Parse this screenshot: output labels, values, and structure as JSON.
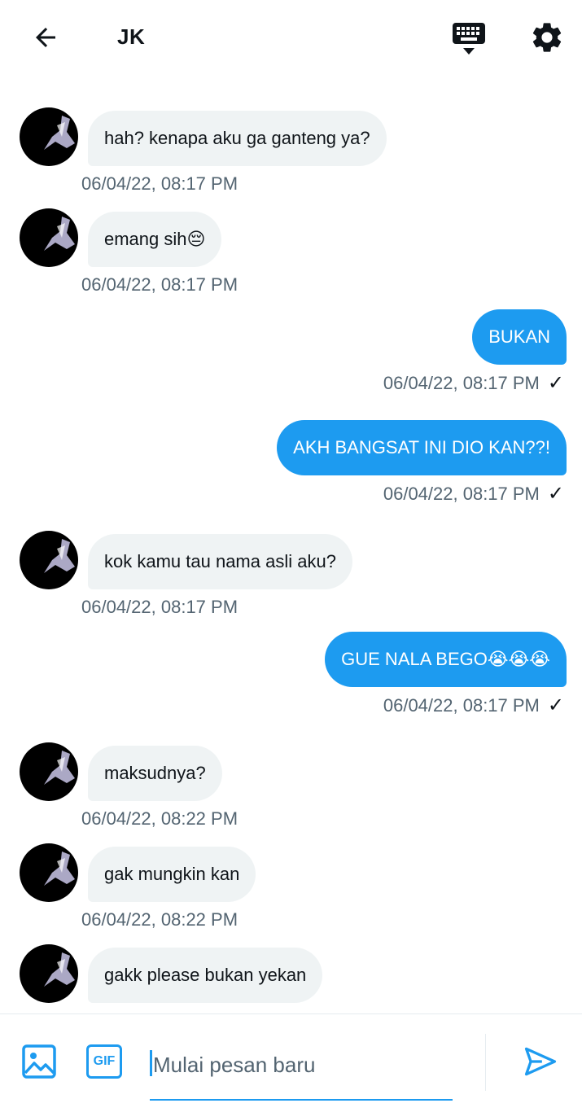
{
  "header": {
    "title": "JK",
    "back_icon": "arrow-left-icon",
    "keyboard_icon": "keyboard-icon",
    "settings_icon": "gear-icon"
  },
  "messages": [
    {
      "direction": "in",
      "text": "hah? kenapa aku ga ganteng ya?",
      "time": "06/04/22, 08:17 PM"
    },
    {
      "direction": "in",
      "text": "emang sih😔",
      "time": "06/04/22, 08:17 PM"
    },
    {
      "direction": "out",
      "text": "BUKAN",
      "time": "06/04/22, 08:17 PM",
      "status": "✓"
    },
    {
      "direction": "out",
      "text": "AKH BANGSAT INI DIO KAN??!",
      "time": "06/04/22, 08:17 PM",
      "status": "✓"
    },
    {
      "direction": "in",
      "text": "kok kamu tau nama asli aku?",
      "time": "06/04/22, 08:17 PM"
    },
    {
      "direction": "out",
      "text": "GUE NALA BEGO😭😭😭",
      "time": "06/04/22, 08:17 PM",
      "status": "✓"
    },
    {
      "direction": "in",
      "text": "maksudnya?",
      "time": "06/04/22, 08:22 PM"
    },
    {
      "direction": "in",
      "text": "gak mungkin kan",
      "time": "06/04/22, 08:22 PM"
    },
    {
      "direction": "in",
      "text": "gakk please bukan yekan",
      "time": ""
    }
  ],
  "composer": {
    "placeholder": "Mulai pesan baru",
    "value": "",
    "gif_label": "GIF",
    "media_icon": "image-icon",
    "send_icon": "send-icon"
  },
  "colors": {
    "accent": "#1d9bf0",
    "incoming_bubble": "#eff3f4",
    "timestamp": "#536471"
  }
}
